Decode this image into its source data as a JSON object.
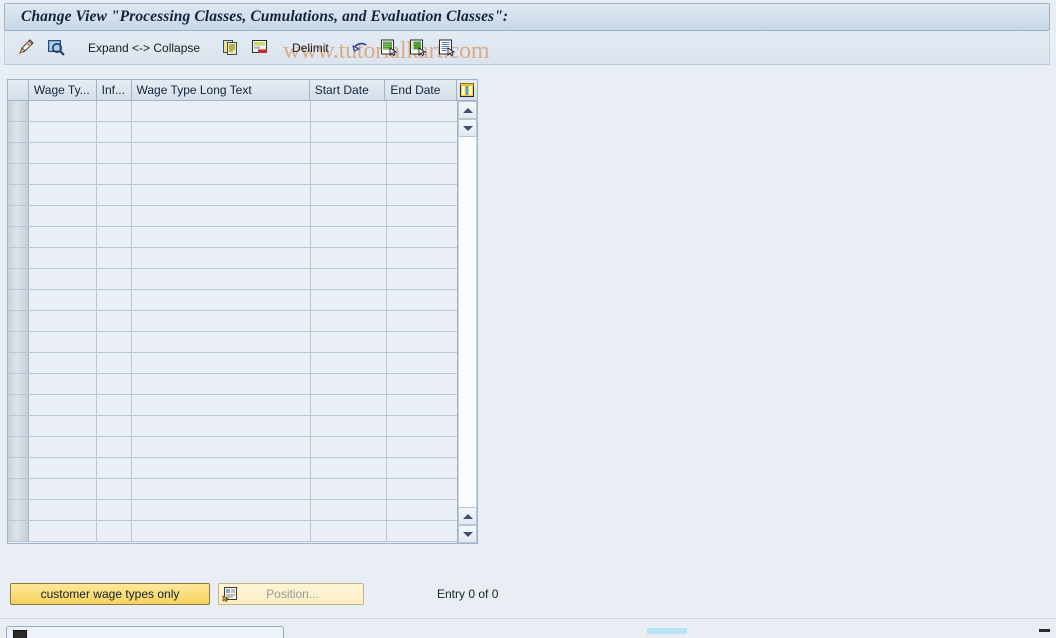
{
  "window": {
    "title": "Change View \"Processing Classes, Cumulations, and Evaluation Classes\":"
  },
  "watermark": {
    "text": "www.tutorialkart.com",
    "color": "#d9a277"
  },
  "toolbar": {
    "items": [
      {
        "name": "display-change-icon",
        "label": "",
        "type": "icon",
        "icon": "pencil-magnifier"
      },
      {
        "name": "check-icon",
        "label": "",
        "type": "icon",
        "icon": "magnifier-box"
      },
      {
        "name": "expand-collapse",
        "label": "Expand <-> Collapse",
        "type": "text"
      },
      {
        "name": "copy-icon",
        "label": "",
        "type": "icon",
        "icon": "copy-documents"
      },
      {
        "name": "delete-icon",
        "label": "",
        "type": "icon",
        "icon": "delete-row"
      },
      {
        "name": "delimit",
        "label": "Delimit",
        "type": "text"
      },
      {
        "name": "undo-icon",
        "label": "",
        "type": "icon",
        "icon": "undo-arrow"
      },
      {
        "name": "select-all-icon",
        "label": "",
        "type": "icon",
        "icon": "select-green"
      },
      {
        "name": "deselect-all-icon",
        "label": "",
        "type": "icon",
        "icon": "deselect-green"
      },
      {
        "name": "details-icon",
        "label": "",
        "type": "icon",
        "icon": "details-lines"
      }
    ]
  },
  "table": {
    "columns": [
      {
        "key": "select",
        "label": ""
      },
      {
        "key": "wage_type",
        "label": "Wage Ty..."
      },
      {
        "key": "infotype",
        "label": "Inf..."
      },
      {
        "key": "long_text",
        "label": "Wage Type Long Text"
      },
      {
        "key": "start_date",
        "label": "Start Date"
      },
      {
        "key": "end_date",
        "label": "End Date"
      },
      {
        "key": "config",
        "label": ""
      }
    ],
    "rows": [],
    "empty_row_count": 21,
    "scrollbar": {
      "up_arrow": "scroll-up-icon",
      "down_arrow": "scroll-down-icon"
    }
  },
  "footer": {
    "customer_wage_types_button": "customer wage types only",
    "position_button": "Position...",
    "entry_count": "Entry 0 of 0"
  },
  "colors": {
    "background": "#e9eef5",
    "title_bar": "#d2dfec",
    "accent_yellow": "#fadd78",
    "grid_border": "#9db3c8",
    "cell_background": "#eaeff6"
  }
}
